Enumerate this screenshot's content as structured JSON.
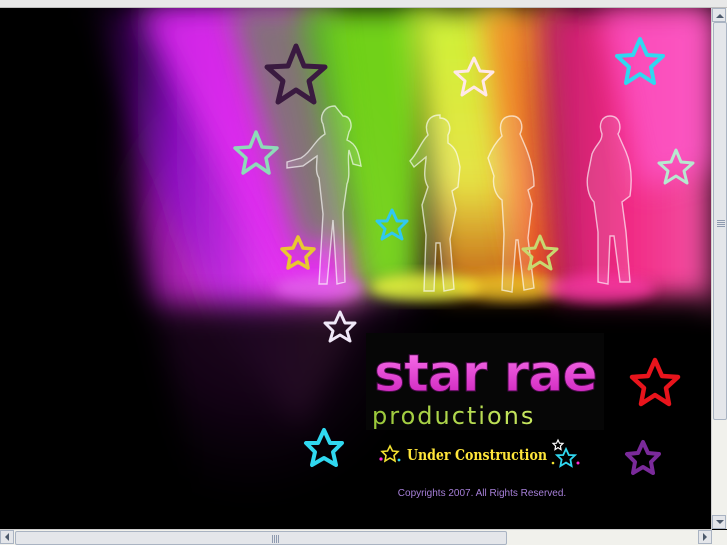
{
  "site": {
    "brand_line1": "star rae",
    "brand_line2": "productions",
    "status": "Under Construction",
    "copyright": "Copyrights 2007. All Rights Reserved."
  },
  "colors": {
    "background": "#000000",
    "magenta": "#ff2ad8",
    "lime": "#b8ff1a",
    "pink": "#ff2a8a",
    "cyan": "#22d8f0",
    "status_text": "#ffe63a",
    "copyright_text": "#a67fd8"
  },
  "icons": [
    "star-icon",
    "silhouette-figure",
    "scroll-arrow-up-icon",
    "scroll-arrow-down-icon",
    "scroll-arrow-left-icon",
    "scroll-arrow-right-icon"
  ]
}
